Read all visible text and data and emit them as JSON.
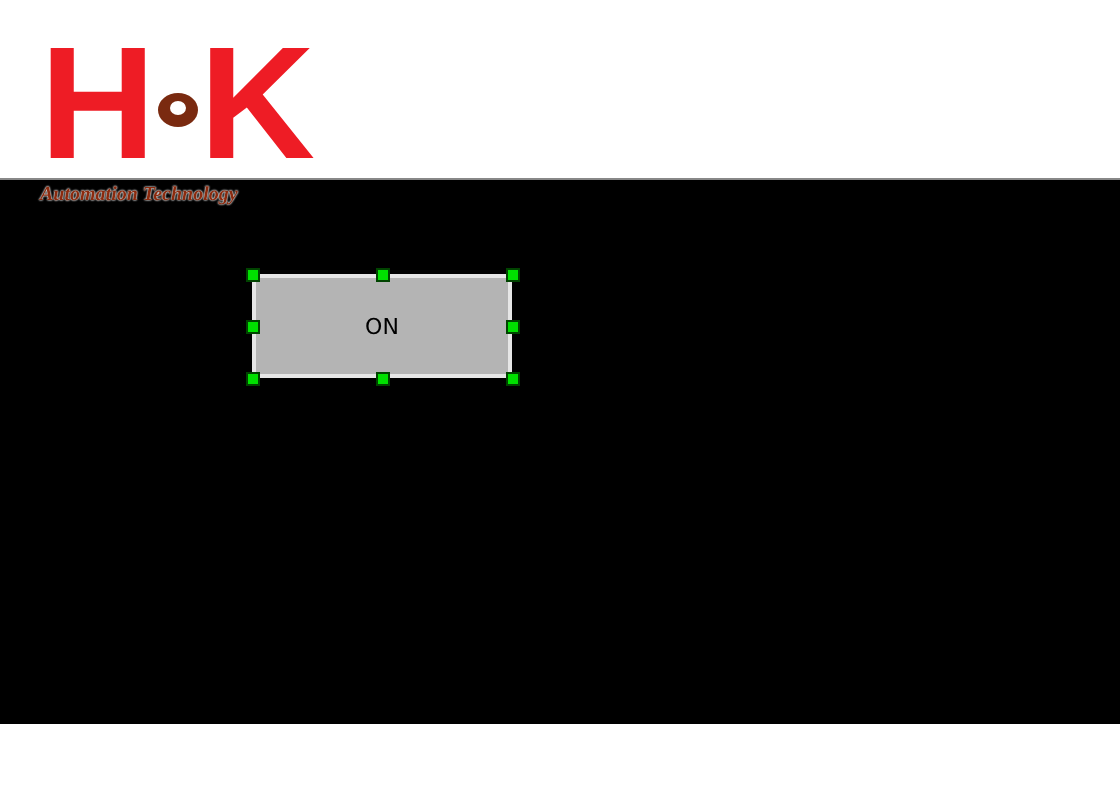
{
  "logo": {
    "letters": [
      "H",
      "K"
    ],
    "tagline": "Automation Technology"
  },
  "canvas": {
    "buttons": [
      {
        "label": "ON",
        "selected": true
      }
    ]
  }
}
